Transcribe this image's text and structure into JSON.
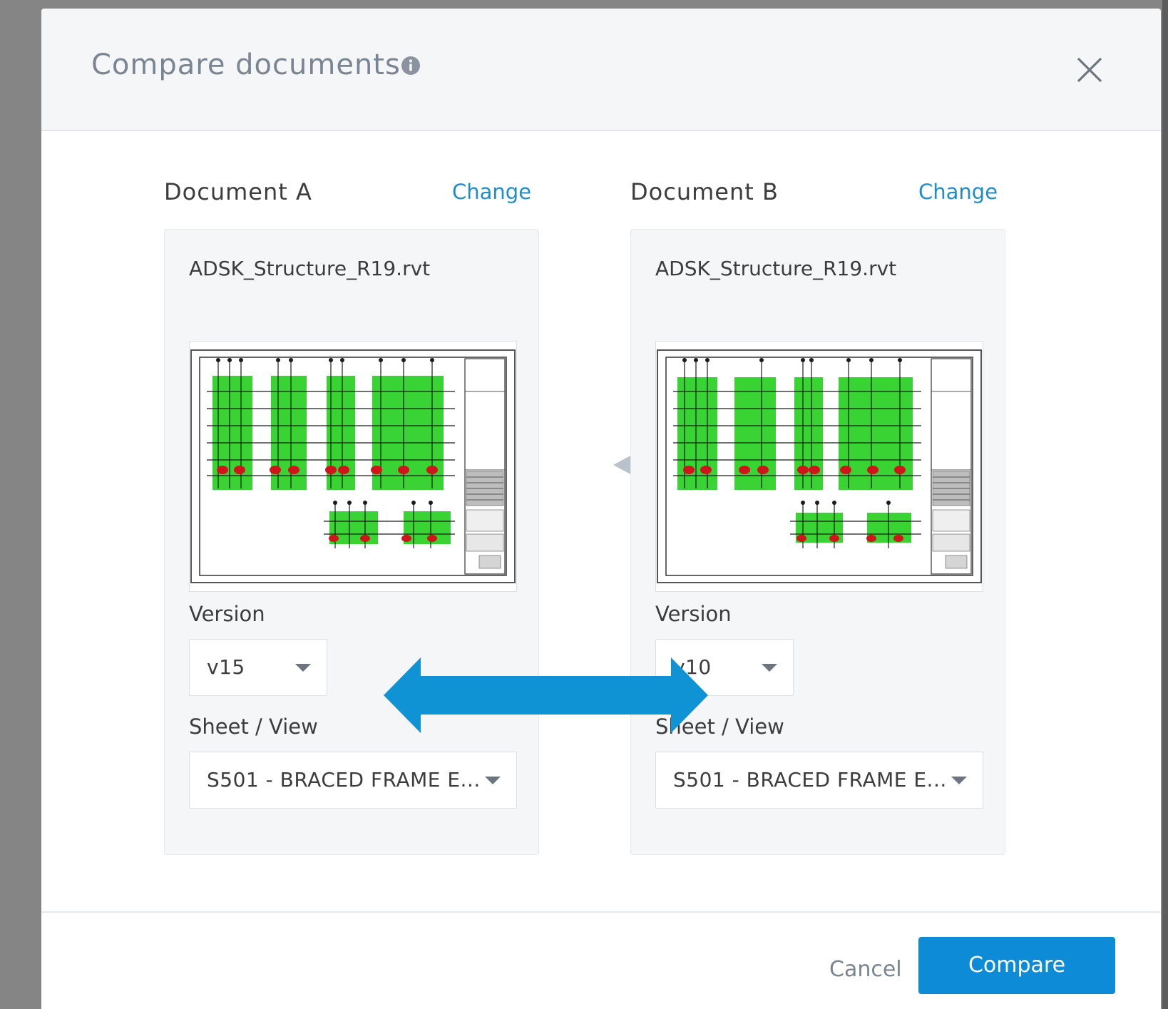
{
  "dialog": {
    "title": "Compare documents",
    "close_icon": "close-icon",
    "info_icon": "info-icon"
  },
  "document_a": {
    "heading": "Document A",
    "change_label": "Change",
    "file_name": "ADSK_Structure_R19.rvt",
    "version_label": "Version",
    "version_value": "v15",
    "sheet_label": "Sheet / View",
    "sheet_value": "S501 - BRACED FRAME E..."
  },
  "document_b": {
    "heading": "Document B",
    "change_label": "Change",
    "file_name": "ADSK_Structure_R19.rvt",
    "version_label": "Version",
    "version_value": "v10",
    "sheet_label": "Sheet / View",
    "sheet_value": "S501 - BRACED FRAME E..."
  },
  "swap_icon": "swap-arrows-icon",
  "annotation_arrow": "double-headed-arrow",
  "footer": {
    "cancel_label": "Cancel",
    "compare_label": "Compare"
  },
  "colors": {
    "accent": "#0e8bd6",
    "link": "#1f8ccf",
    "annotation_arrow": "#0f93d4",
    "drawing_highlight": "#2fd12a",
    "drawing_red": "#d0141c"
  }
}
